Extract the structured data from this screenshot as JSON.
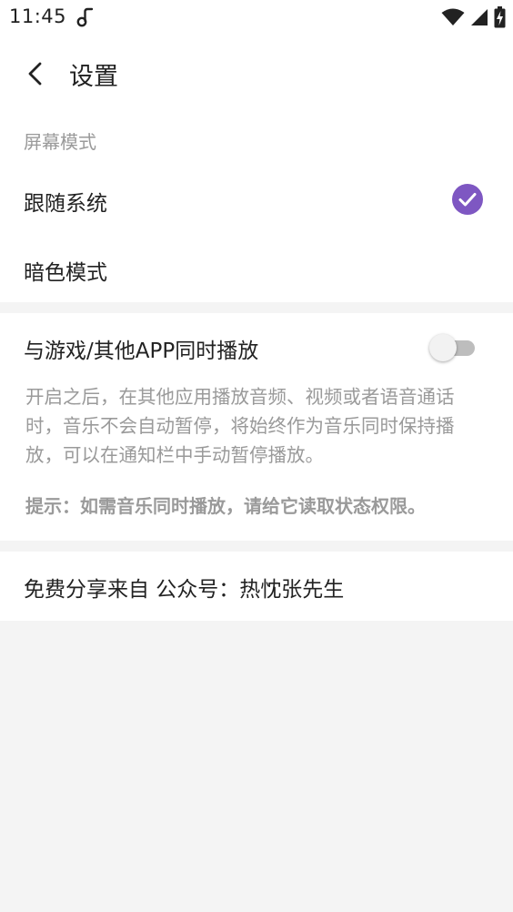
{
  "status_bar": {
    "time": "11:45",
    "icons": [
      "music-note-icon",
      "wifi-icon",
      "cellular-signal-icon",
      "battery-charging-icon"
    ]
  },
  "header": {
    "title": "设置",
    "back_icon": "back-arrow-icon"
  },
  "screen_mode": {
    "section_title": "屏幕模式",
    "options": [
      {
        "label": "跟随系统",
        "selected": true
      },
      {
        "label": "暗色模式",
        "selected": false
      }
    ],
    "check_icon": "check-circle-icon"
  },
  "play_with_others": {
    "label": "与游戏/其他APP同时播放",
    "enabled": false,
    "description": "开启之后，在其他应用播放音频、视频或者语音通话时，音乐不会自动暂停，将始终作为音乐同时保持播放，可以在通知栏中手动暂停播放。",
    "hint": "提示：如需音乐同时播放，请给它读取状态权限。"
  },
  "share": {
    "text": "免费分享来自 公众号：热忱张先生"
  },
  "colors": {
    "accent": "#7e57c2",
    "background": "#f4f4f4",
    "card": "#ffffff",
    "secondary_text": "#9a9a9a",
    "primary_text": "#222222"
  }
}
